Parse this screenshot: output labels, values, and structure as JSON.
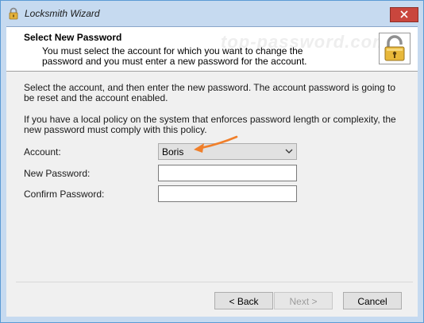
{
  "window": {
    "title": "Locksmith Wizard",
    "close_icon": "close-icon",
    "title_icon": "padlock-icon"
  },
  "header": {
    "title": "Select New Password",
    "description": "You must select the account for which you want to change the password and you must enter a new password for the account.",
    "watermark": "top-password.com",
    "icon": "padlock-icon"
  },
  "body": {
    "paragraph1": "Select the account, and then enter the new password. The account password is going to be reset and the account enabled.",
    "paragraph2": "If you have a local policy on the system that enforces password length or complexity, the new password must comply with this policy."
  },
  "form": {
    "account_label": "Account:",
    "account_value": "Boris",
    "new_password_label": "New Password:",
    "new_password_value": "",
    "confirm_password_label": "Confirm Password:",
    "confirm_password_value": ""
  },
  "buttons": {
    "back": "< Back",
    "next": "Next >",
    "cancel": "Cancel"
  },
  "colors": {
    "annotation_arrow": "#f07f2a",
    "close_button": "#c9463d",
    "frame": "#c6daf0"
  }
}
